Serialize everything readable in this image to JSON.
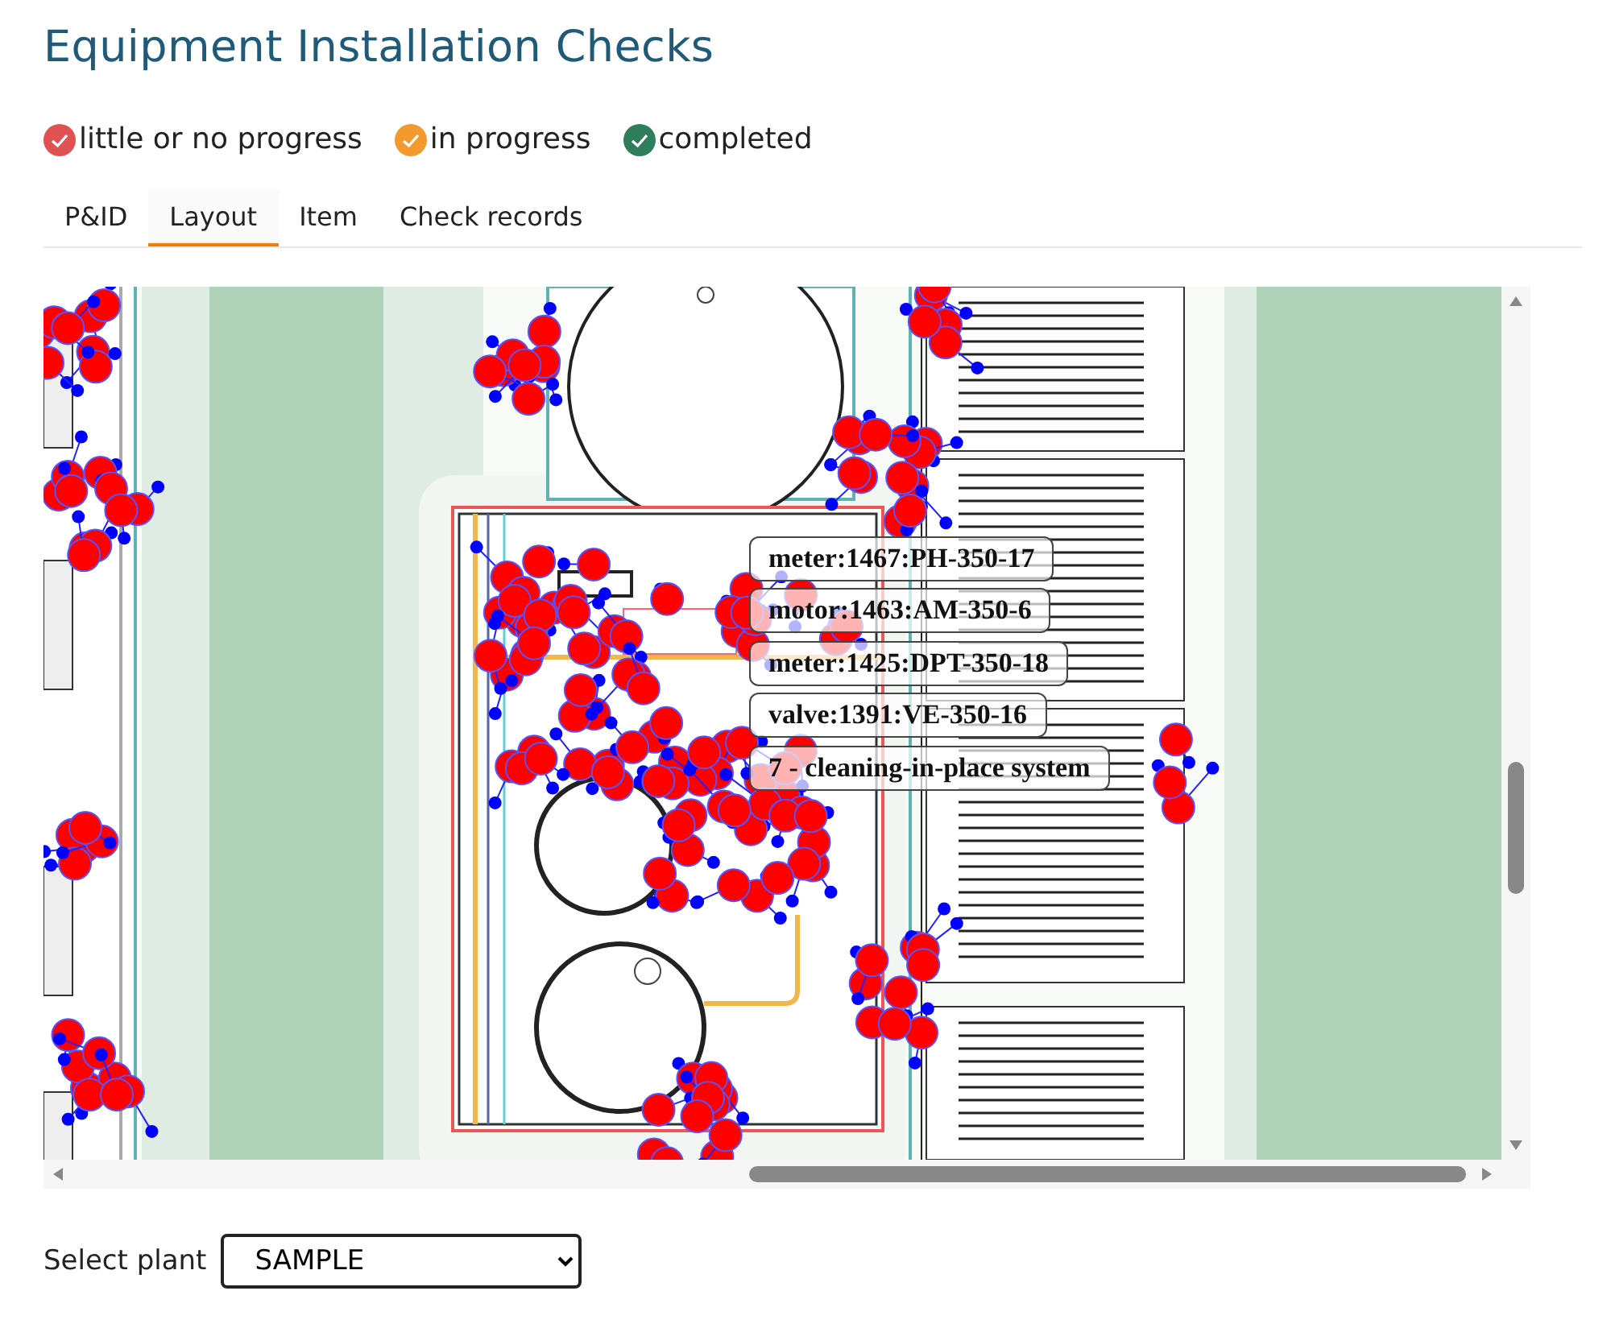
{
  "title": "Equipment Installation Checks",
  "legend": [
    {
      "label": "little or no progress",
      "color": "#e05252"
    },
    {
      "label": "in progress",
      "color": "#f39a2e"
    },
    {
      "label": "completed",
      "color": "#2e7d5b"
    }
  ],
  "tabs": [
    {
      "label": "P&ID",
      "selected": false
    },
    {
      "label": "Layout",
      "selected": true
    },
    {
      "label": "Item",
      "selected": false
    },
    {
      "label": "Check records",
      "selected": false
    }
  ],
  "layout": {
    "tags": [
      "meter:1467:PH-350-17",
      "motor:1463:AM-350-6",
      "meter:1425:DPT-350-18",
      "valve:1391:VE-350-16",
      "7 - cleaning-in-place system"
    ]
  },
  "plant_select": {
    "label": "Select plant",
    "value": "SAMPLE"
  }
}
